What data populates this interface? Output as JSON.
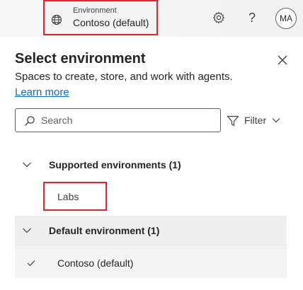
{
  "header": {
    "env_caption": "Environment",
    "env_name": "Contoso (default)",
    "help_glyph": "?",
    "avatar_initials": "MA",
    "icons": [
      "globe-icon",
      "gear-icon",
      "help-icon"
    ]
  },
  "panel": {
    "title": "Select environment",
    "description": "Spaces to create, store, and work with agents.",
    "learn_more": "Learn more",
    "search": {
      "placeholder": "Search",
      "value": ""
    },
    "filter_label": "Filter"
  },
  "groups": [
    {
      "label": "Supported environments (1)",
      "items": [
        "Labs"
      ]
    },
    {
      "label": "Default environment (1)",
      "items": [
        "Contoso (default)"
      ]
    }
  ],
  "colors": {
    "highlight_border": "#e0242b",
    "link": "#0f6cbd",
    "selected_bg": "#eeeeee"
  }
}
